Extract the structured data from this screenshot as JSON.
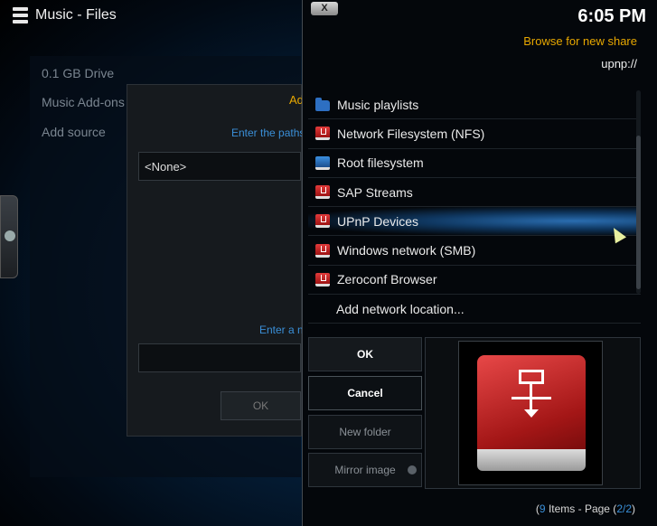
{
  "window": {
    "title": "Music - Files"
  },
  "sources": {
    "items": [
      "0.1 GB Drive",
      "Music Add-ons",
      "Add source"
    ]
  },
  "source_dialog": {
    "title": "Add",
    "paths_hint": "Enter the paths or",
    "path_value": "<None>",
    "name_hint": "Enter a nam",
    "ok_label": "OK"
  },
  "browse_dialog": {
    "close_label": "X",
    "clock": "6:05 PM",
    "heading": "Browse for new share",
    "path": "upnp://",
    "items": [
      {
        "label": "Music playlists",
        "icon": "folder-icon"
      },
      {
        "label": "Network Filesystem (NFS)",
        "icon": "network-drive-icon"
      },
      {
        "label": "Root filesystem",
        "icon": "drive-icon"
      },
      {
        "label": "SAP Streams",
        "icon": "network-drive-icon"
      },
      {
        "label": "UPnP Devices",
        "icon": "network-drive-icon"
      },
      {
        "label": "Windows network (SMB)",
        "icon": "network-drive-icon"
      },
      {
        "label": "Zeroconf Browser",
        "icon": "network-drive-icon"
      },
      {
        "label": "Add network location...",
        "icon": ""
      }
    ],
    "selected_index": 4,
    "buttons": {
      "ok": "OK",
      "cancel": "Cancel",
      "new_folder": "New folder",
      "mirror_image": "Mirror image"
    },
    "footer": {
      "count": "9",
      "items_text": " Items - Page (",
      "page": "2/2",
      "close_paren": ")"
    }
  },
  "colors": {
    "accent_orange": "#e8a800",
    "accent_blue": "#3a8fd8",
    "drive_red": "#c42020"
  }
}
